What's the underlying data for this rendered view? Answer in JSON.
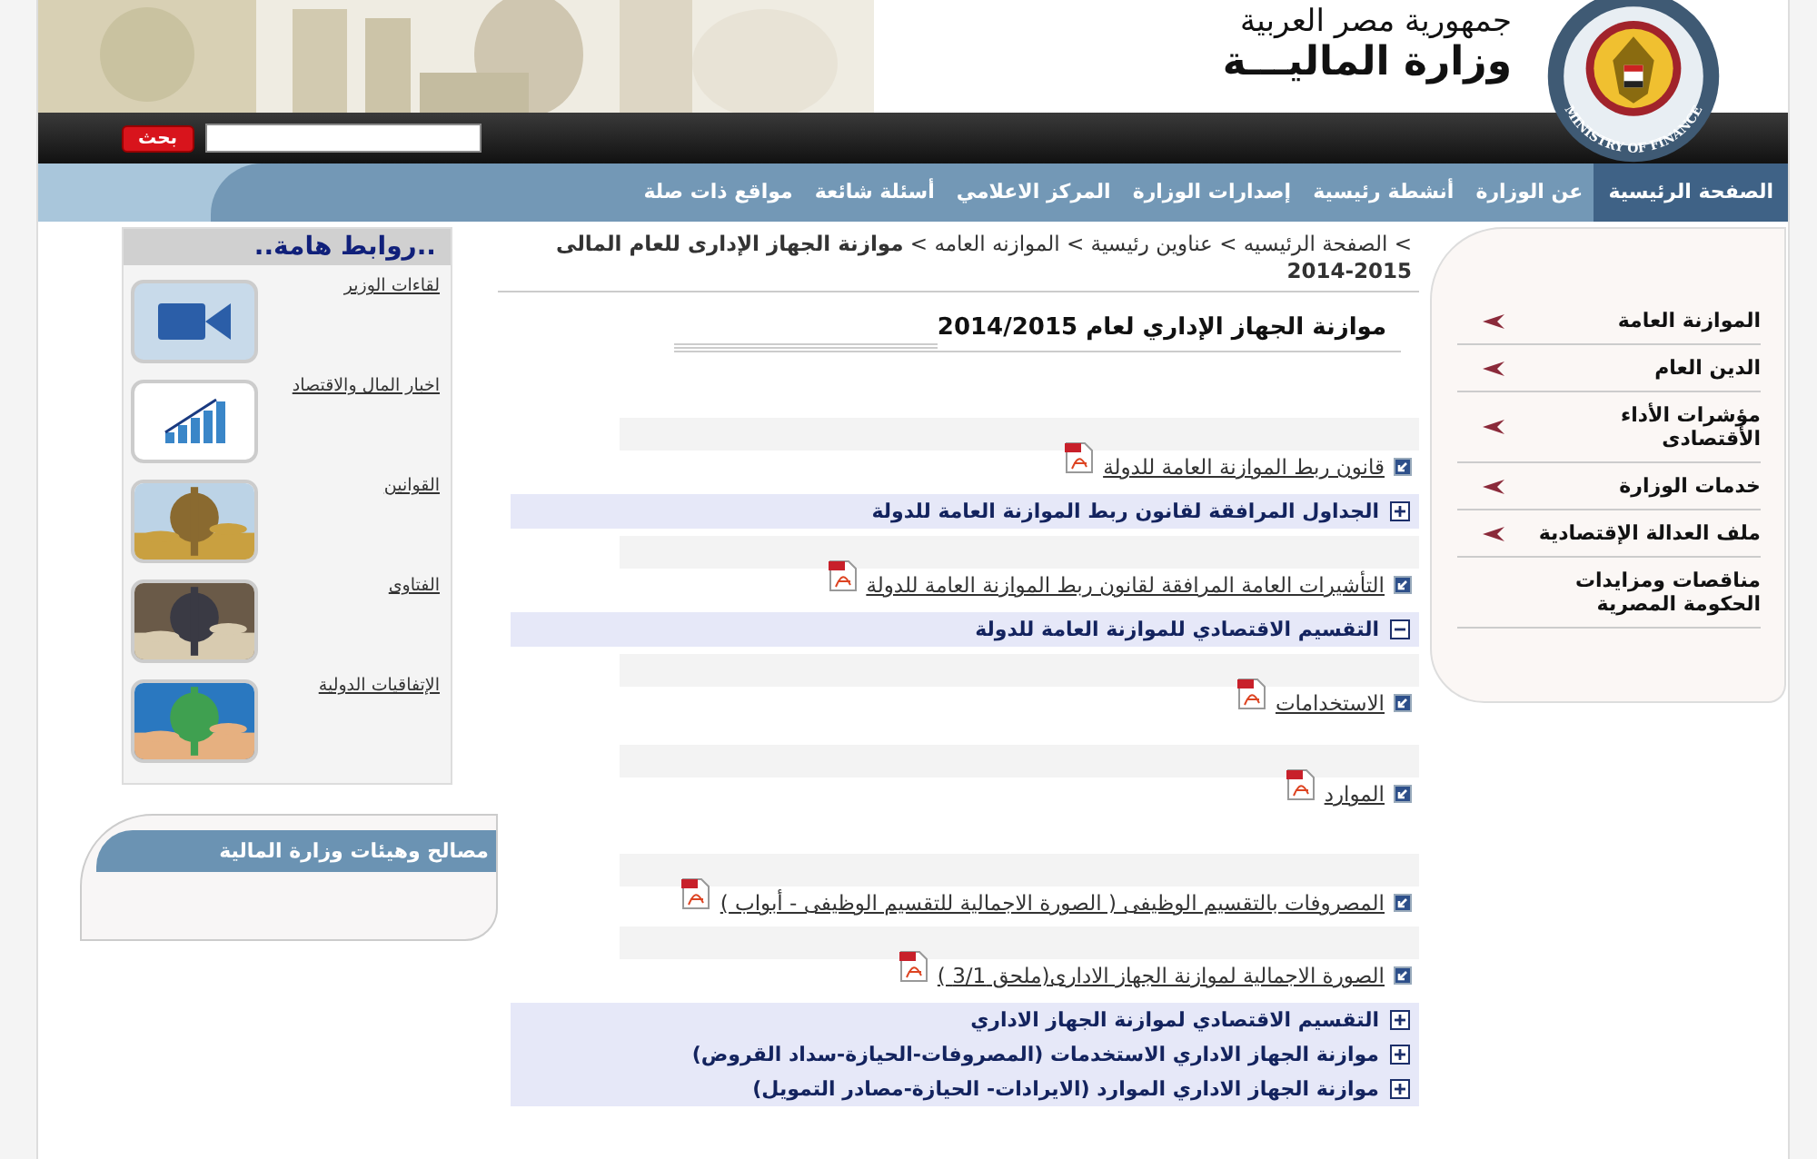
{
  "header": {
    "country": "جمهورية مصر العربية",
    "ministry": "وزارة الماليـــة",
    "logo_text": "MINISTRY OF FINANCE"
  },
  "search": {
    "button": "بحث"
  },
  "nav": [
    {
      "label": "الصفحة الرئيسية",
      "selected": true
    },
    {
      "label": "عن الوزارة",
      "selected": false
    },
    {
      "label": "أنشطة رئيسية",
      "selected": false
    },
    {
      "label": "إصدارات الوزارة",
      "selected": false
    },
    {
      "label": "المركز الاعلامي",
      "selected": false
    },
    {
      "label": "أسئلة شائعة",
      "selected": false
    },
    {
      "label": "مواقع ذات صلة",
      "selected": false
    }
  ],
  "sidebar": {
    "items": [
      {
        "label": "الموازنة العامة",
        "arrow": true
      },
      {
        "label": "الدين العام",
        "arrow": true
      },
      {
        "label": "مؤشرات الأداء الأقتصادى",
        "arrow": true
      },
      {
        "label": "خدمات الوزارة",
        "arrow": true
      },
      {
        "label": "ملف العدالة الإقتصادية",
        "arrow": true
      },
      {
        "label": "مناقصات ومزايدات الحكومة المصرية",
        "arrow": false
      }
    ]
  },
  "breadcrumb": "> الصفحة الرئيسيه > عناوين رئيسية > الموازنه العامه > **موازنة الجهاز الإدارى للعام المالى 2015-2014**",
  "page_title": "موازنة الجهاز الإداري لعام 2014/2015",
  "items": [
    {
      "kind": "link",
      "label": "قانون ربط الموازنة العامة للدولة"
    },
    {
      "kind": "section",
      "label": "الجداول المرافقة لقانون ربط الموازنة العامة للدولة",
      "expanded": false
    },
    {
      "kind": "link",
      "label": "التأشيرات العامة المرافقة لقانون ربط الموازنة العامة للدولة"
    },
    {
      "kind": "section",
      "label": "التقسيم الاقتصادي للموازنة العامة للدولة",
      "expanded": true
    },
    {
      "kind": "link",
      "label": "الاستخدامات"
    },
    {
      "kind": "link",
      "label": "الموارد"
    },
    {
      "kind": "link",
      "label": "المصروفات بالتقسيم الوظيفى ( الصورة الاجمالية للتقسيم الوظيفى - أبواب )"
    },
    {
      "kind": "link",
      "label": "الصورة الاجمالية لموازنة الجهاز الادارى(ملحق 3/1 )"
    },
    {
      "kind": "section",
      "label": "التقسيم الاقتصادي لموازنة الجهاز الاداري",
      "expanded": false
    },
    {
      "kind": "section",
      "label": "موازنة الجهاز الاداري الاستخدمات (المصروفات-الحيازة-سداد القروض)",
      "expanded": false
    },
    {
      "kind": "section",
      "label": "موازنة الجهاز الاداري الموارد (الايرادات- الحيازة-مصادر التمويل)",
      "expanded": false
    }
  ],
  "links_box": {
    "title": "..روابط هامة..",
    "links": [
      {
        "label": "لقاءات الوزير",
        "kind": "icon"
      },
      {
        "label": "اخبار المال والاقتصاد",
        "kind": "icon"
      },
      {
        "label": "القوانين",
        "kind": "picture"
      },
      {
        "label": "الفتاوى",
        "kind": "picture"
      },
      {
        "label": "الإتفاقيات الدولية",
        "kind": "picture"
      }
    ]
  },
  "agencies_box": {
    "title": "مصالح وهيئات وزارة المالية"
  }
}
